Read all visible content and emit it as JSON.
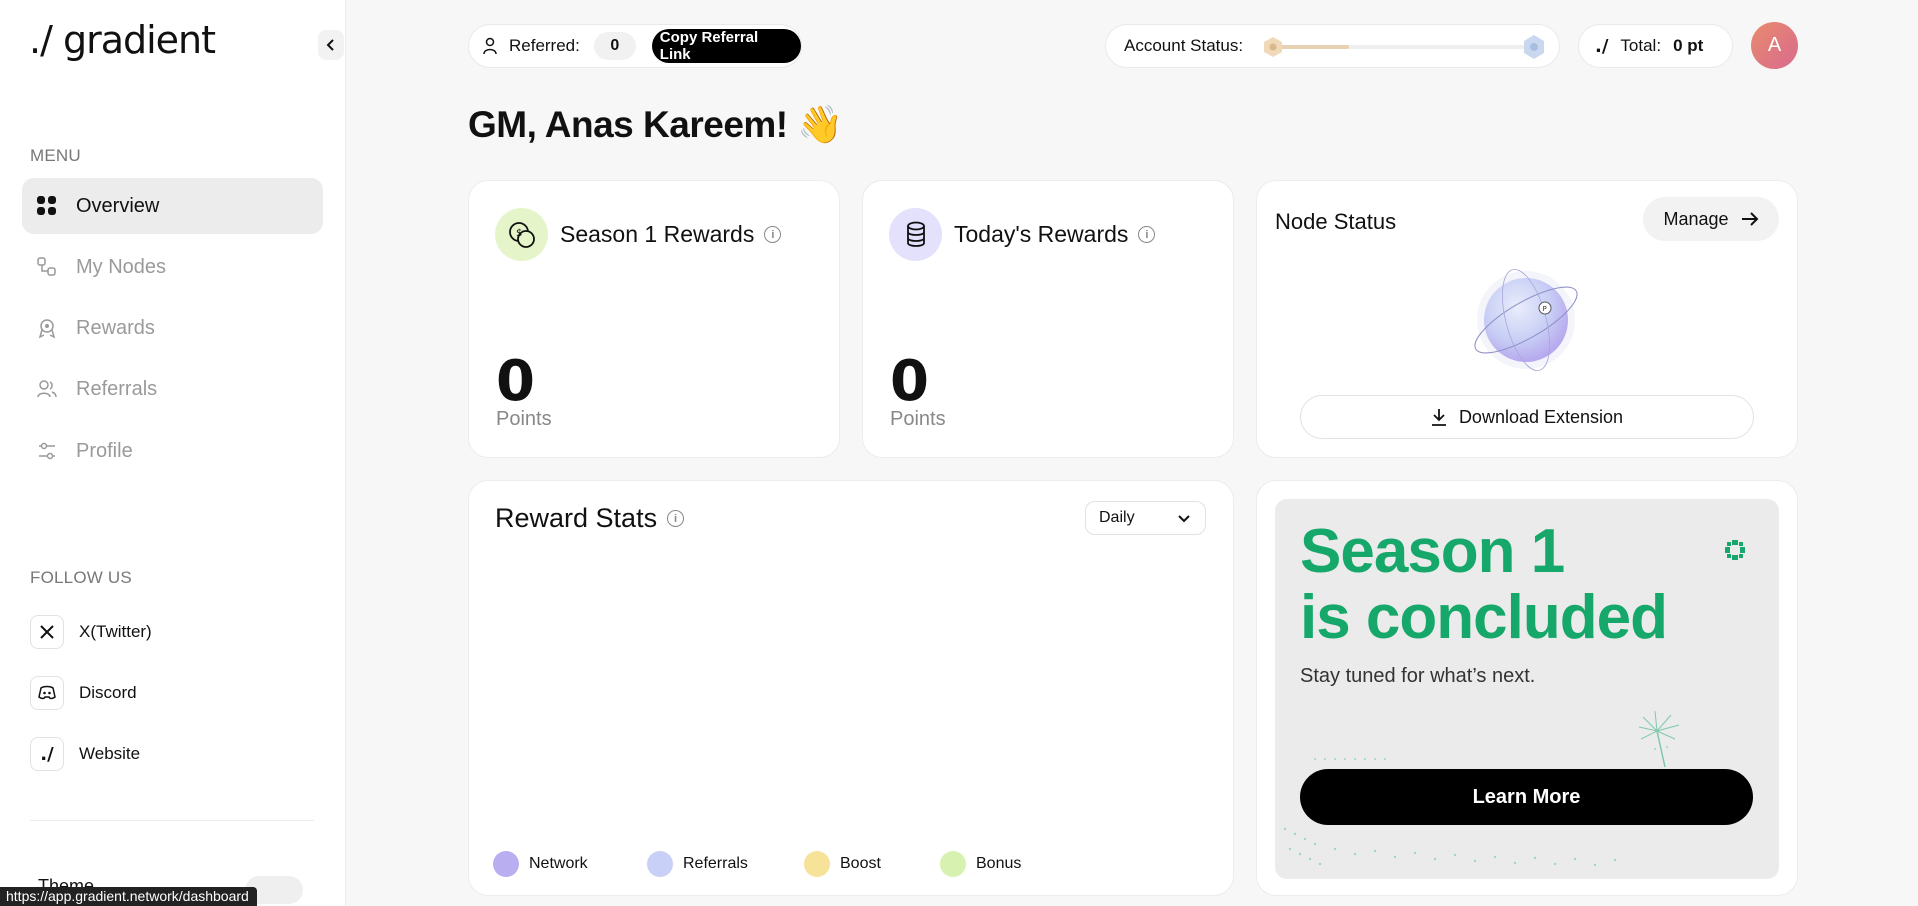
{
  "app": {
    "logo": "./ gradient"
  },
  "sidebar": {
    "menu_label": "MENU",
    "items": [
      {
        "label": "Overview",
        "icon": "grid-icon",
        "active": true
      },
      {
        "label": "My Nodes",
        "icon": "nodes-icon",
        "active": false
      },
      {
        "label": "Rewards",
        "icon": "award-icon",
        "active": false
      },
      {
        "label": "Referrals",
        "icon": "users-icon",
        "active": false
      },
      {
        "label": "Profile",
        "icon": "sliders-icon",
        "active": false
      }
    ],
    "follow_label": "FOLLOW US",
    "socials": [
      {
        "label": "X(Twitter)",
        "icon": "x-icon"
      },
      {
        "label": "Discord",
        "icon": "discord-icon"
      },
      {
        "label": "Website",
        "icon": "gradient-icon"
      }
    ],
    "theme_label": "Theme"
  },
  "status_bar": {
    "url": "https://app.gradient.network/dashboard"
  },
  "topbar": {
    "referred_label": "Referred:",
    "referred_count": "0",
    "copy_link_label": "Copy Referral Link",
    "account_status_label": "Account Status:",
    "account_status_progress": 0.3,
    "total_icon": "./",
    "total_label": "Total:",
    "total_value": "0 pt",
    "avatar_initial": "A"
  },
  "greeting": "GM, Anas Kareem! 👋",
  "season_rewards": {
    "title": "Season 1 Rewards",
    "value": "0",
    "unit": "Points"
  },
  "today_rewards": {
    "title": "Today's Rewards",
    "value": "0",
    "unit": "Points"
  },
  "node_status": {
    "title": "Node Status",
    "manage_label": "Manage",
    "download_label": "Download Extension"
  },
  "reward_stats": {
    "title": "Reward Stats",
    "period": "Daily",
    "legend": [
      {
        "name": "Network",
        "color": "#b9aef0"
      },
      {
        "name": "Referrals",
        "color": "#c9d0f7"
      },
      {
        "name": "Boost",
        "color": "#f7e29a"
      },
      {
        "name": "Bonus",
        "color": "#d7f2b0"
      }
    ]
  },
  "promo": {
    "title_line1": "Season 1",
    "title_line2": "is concluded",
    "subtitle": "Stay tuned for what’s next.",
    "button_label": "Learn More",
    "accent": "#16a86a"
  }
}
